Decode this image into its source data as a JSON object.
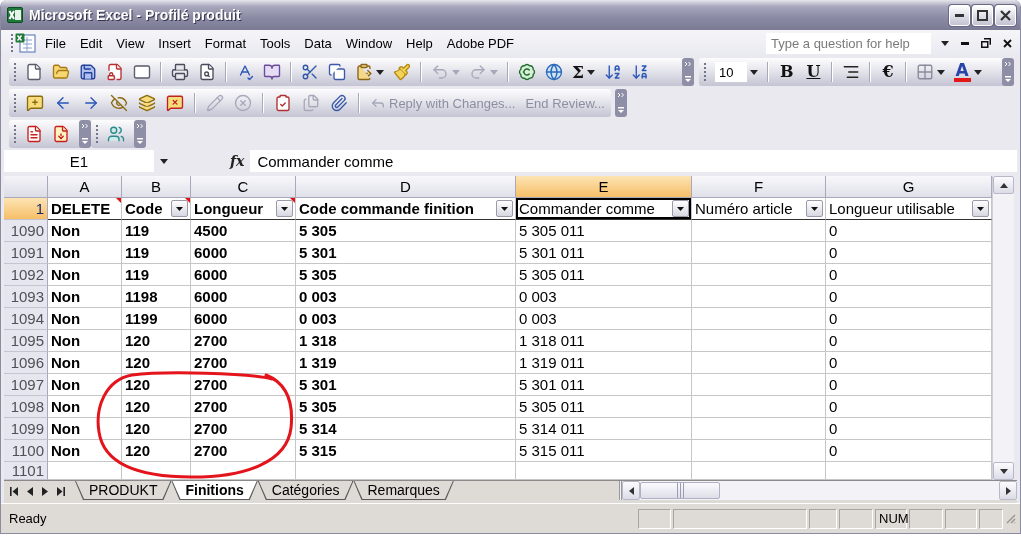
{
  "window": {
    "title": "Microsoft Excel - Profilé produit"
  },
  "menu_bar": {
    "items": [
      "File",
      "Edit",
      "View",
      "Insert",
      "Format",
      "Tools",
      "Data",
      "Window",
      "Help",
      "Adobe PDF"
    ],
    "help_box": {
      "placeholder": "Type a question for help"
    }
  },
  "standard_toolbar": {
    "autosum": "Σ",
    "undo": {
      "disabled": true
    },
    "redo": {
      "disabled": true
    }
  },
  "formatting_toolbar": {
    "font_size": "10",
    "bold": "B",
    "underline": "U",
    "currency": "€",
    "font_color": "A"
  },
  "reviewing_toolbar": {
    "buttons": [
      {
        "disabled": false
      },
      {
        "disabled": false
      },
      {
        "disabled": false
      },
      {
        "disabled": false
      },
      {
        "disabled": false
      },
      {
        "disabled": false
      },
      {
        "disabled": true
      },
      {
        "disabled": true
      },
      {
        "disabled": false
      },
      {
        "disabled": true
      },
      {
        "disabled": false
      }
    ],
    "reply": {
      "label": "Reply with Changes...",
      "disabled": true
    },
    "end_review": {
      "label": "End Review...",
      "disabled": true
    }
  },
  "formula_bar": {
    "name_box": "E1",
    "function_label": "fx",
    "formula": "Commander comme"
  },
  "table": {
    "columns": [
      {
        "letter": "A",
        "selected": false,
        "bold": true
      },
      {
        "letter": "B",
        "selected": false,
        "bold": true
      },
      {
        "letter": "C",
        "selected": false,
        "bold": true
      },
      {
        "letter": "D",
        "selected": false,
        "bold": true
      },
      {
        "letter": "E",
        "selected": true,
        "bold": false
      },
      {
        "letter": "F",
        "selected": false,
        "bold": false
      },
      {
        "letter": "G",
        "selected": false,
        "bold": false
      }
    ],
    "header_row": {
      "number": "1",
      "selected": true,
      "cells": [
        {
          "text": "DELETE",
          "filter": false,
          "comment": true,
          "active": false
        },
        {
          "text": "Code",
          "filter": true,
          "comment": true,
          "active": false
        },
        {
          "text": "Longueur",
          "filter": true,
          "comment": true,
          "active": false
        },
        {
          "text": "Code commande finition",
          "filter": true,
          "comment": false,
          "active": false
        },
        {
          "text": "Commander comme",
          "filter": true,
          "comment": false,
          "active": true
        },
        {
          "text": "Numéro article",
          "filter": true,
          "comment": false,
          "active": false
        },
        {
          "text": "Longueur utilisable",
          "filter": true,
          "comment": false,
          "active": false
        }
      ]
    },
    "rows": [
      {
        "number": "1090",
        "selected": false,
        "cells": [
          "Non",
          "119",
          "4500",
          "5 305",
          "5 305 011",
          null,
          "0"
        ]
      },
      {
        "number": "1091",
        "selected": false,
        "cells": [
          "Non",
          "119",
          "6000",
          "5 301",
          "5 301 011",
          null,
          "0"
        ]
      },
      {
        "number": "1092",
        "selected": false,
        "cells": [
          "Non",
          "119",
          "6000",
          "5 305",
          "5 305 011",
          null,
          "0"
        ]
      },
      {
        "number": "1093",
        "selected": false,
        "cells": [
          "Non",
          "1198",
          "6000",
          "0 003",
          "0 003",
          null,
          "0"
        ]
      },
      {
        "number": "1094",
        "selected": false,
        "cells": [
          "Non",
          "1199",
          "6000",
          "0 003",
          "0 003",
          null,
          "0"
        ]
      },
      {
        "number": "1095",
        "selected": false,
        "cells": [
          "Non",
          "120",
          "2700",
          "1 318",
          "1 318 011",
          null,
          "0"
        ]
      },
      {
        "number": "1096",
        "selected": false,
        "cells": [
          "Non",
          "120",
          "2700",
          "1 319",
          "1 319 011",
          null,
          "0"
        ]
      },
      {
        "number": "1097",
        "selected": false,
        "cells": [
          "Non",
          "120",
          "2700",
          "5 301",
          "5 301 011",
          null,
          "0"
        ]
      },
      {
        "number": "1098",
        "selected": false,
        "cells": [
          "Non",
          "120",
          "2700",
          "5 305",
          "5 305 011",
          null,
          "0"
        ]
      },
      {
        "number": "1099",
        "selected": false,
        "cells": [
          "Non",
          "120",
          "2700",
          "5 314",
          "5 314 011",
          null,
          "0"
        ]
      },
      {
        "number": "1100",
        "selected": false,
        "cells": [
          "Non",
          "120",
          "2700",
          "5 315",
          "5 315 011",
          null,
          "0"
        ]
      },
      {
        "number": "1101",
        "selected": false,
        "cells": []
      }
    ]
  },
  "annotation": {
    "kind": "freehand_circle"
  },
  "sheet_tabs": [
    {
      "label": "PRODUKT",
      "selected": false
    },
    {
      "label": "Finitions",
      "selected": true
    },
    {
      "label": "Catégories",
      "selected": false
    },
    {
      "label": "Remarques",
      "selected": false
    }
  ],
  "status_bar": {
    "text": "Ready",
    "indicators": [
      "NUM"
    ]
  }
}
